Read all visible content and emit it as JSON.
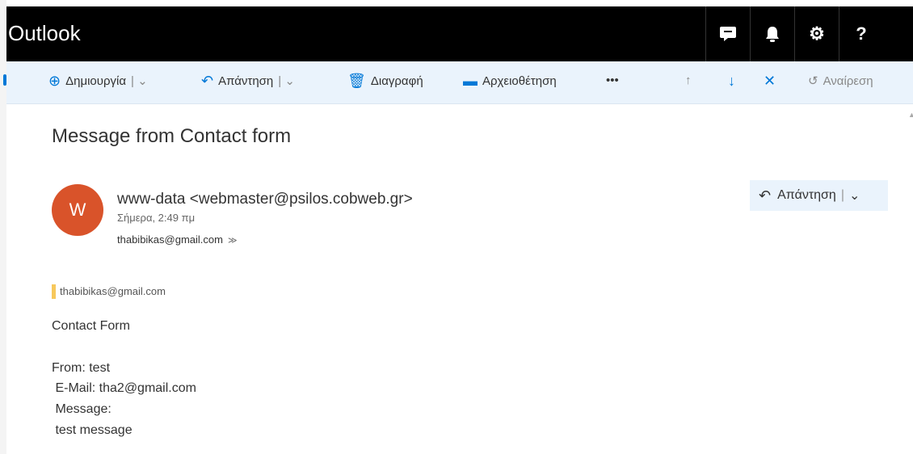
{
  "app": {
    "title": "Outlook"
  },
  "topbar": {
    "icons": [
      "chat-icon",
      "bell-icon",
      "gear-icon",
      "help-icon"
    ],
    "icon_glyphs": [
      "▼",
      "▲",
      "⚙",
      "?"
    ]
  },
  "toolbar": {
    "new_label": "Δημιουργία",
    "reply_label": "Απάντηση",
    "delete_label": "Διαγραφή",
    "archive_label": "Αρχειοθέτηση",
    "more_label": "•••",
    "undo_label": "Αναίρεση"
  },
  "message": {
    "subject": "Message from Contact form",
    "avatar_initial": "W",
    "avatar_color": "#d9532a",
    "from": "www-data <webmaster@psilos.cobweb.gr>",
    "date": "Σήμερα, 2:49 πμ",
    "to": "thabibikas@gmail.com",
    "reply_button_label": "Απάντηση",
    "quote_email": "thabibikas@gmail.com",
    "body": [
      "Contact Form",
      "From: test",
      " E-Mail: tha2@gmail.com",
      " Message:",
      " test message"
    ]
  },
  "colors": {
    "accent": "#0078d7",
    "topbar": "#000000",
    "toolbar_bg": "#eaf3fc",
    "quote_bar": "#f7c85c"
  }
}
